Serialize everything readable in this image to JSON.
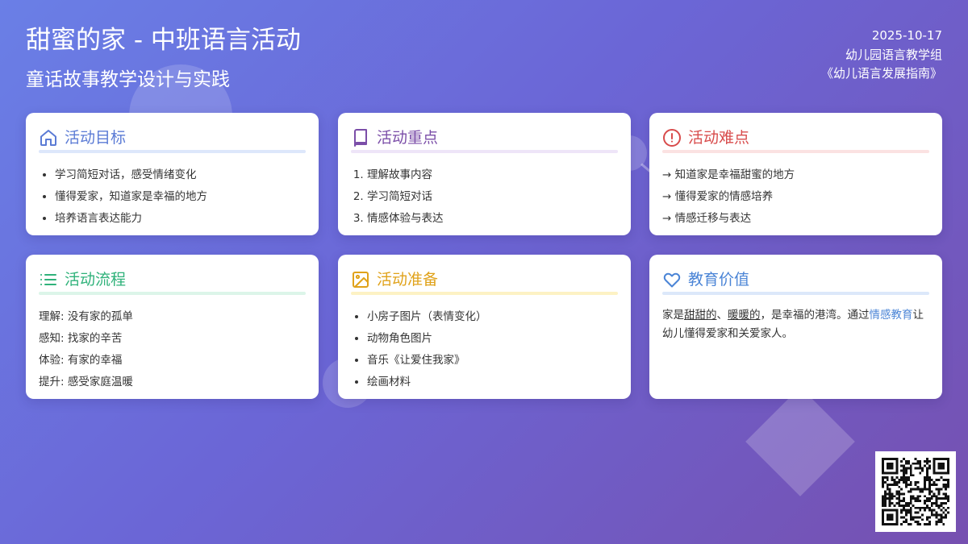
{
  "header": {
    "title": "甜蜜的家 - 中班语言活动",
    "subtitle": "童话故事教学设计与实践",
    "date": "2025-10-17",
    "group": "幼儿园语言教学组",
    "reference": "《幼儿语言发展指南》"
  },
  "cards": {
    "goals": {
      "title": "活动目标",
      "icon": "home-icon",
      "color": "#5b7bd5",
      "items": [
        "学习简短对话，感受情绪变化",
        "懂得爱家，知道家是幸福的地方",
        "培养语言表达能力"
      ]
    },
    "focus": {
      "title": "活动重点",
      "icon": "book-icon",
      "color": "#7b4ea8",
      "items": [
        "理解故事内容",
        "学习简短对话",
        "情感体验与表达"
      ]
    },
    "difficulty": {
      "title": "活动难点",
      "icon": "alert-icon",
      "color": "#d84b4b",
      "items": [
        "→ 知道家是幸福甜蜜的地方",
        "→ 懂得爱家的情感培养",
        "→ 情感迁移与表达"
      ]
    },
    "process": {
      "title": "活动流程",
      "icon": "list-icon",
      "color": "#2fb27a",
      "items": [
        "理解: 没有家的孤单",
        "感知: 找家的辛苦",
        "体验: 有家的幸福",
        "提升: 感受家庭温暖"
      ]
    },
    "prep": {
      "title": "活动准备",
      "icon": "image-icon",
      "color": "#e0a21a",
      "items": [
        "小房子图片（表情变化）",
        "动物角色图片",
        "音乐《让爱住我家》",
        "绘画材料"
      ]
    },
    "value": {
      "title": "教育价值",
      "icon": "heart-icon",
      "color": "#4a84d6",
      "text_1": "家是",
      "word_1": "甜甜的",
      "text_2": "、",
      "word_2": "暖暖的",
      "text_3": "，是幸福的港湾。通过",
      "highlight": "情感教育",
      "text_4": "让幼儿懂得爱家和关爱家人。"
    }
  }
}
